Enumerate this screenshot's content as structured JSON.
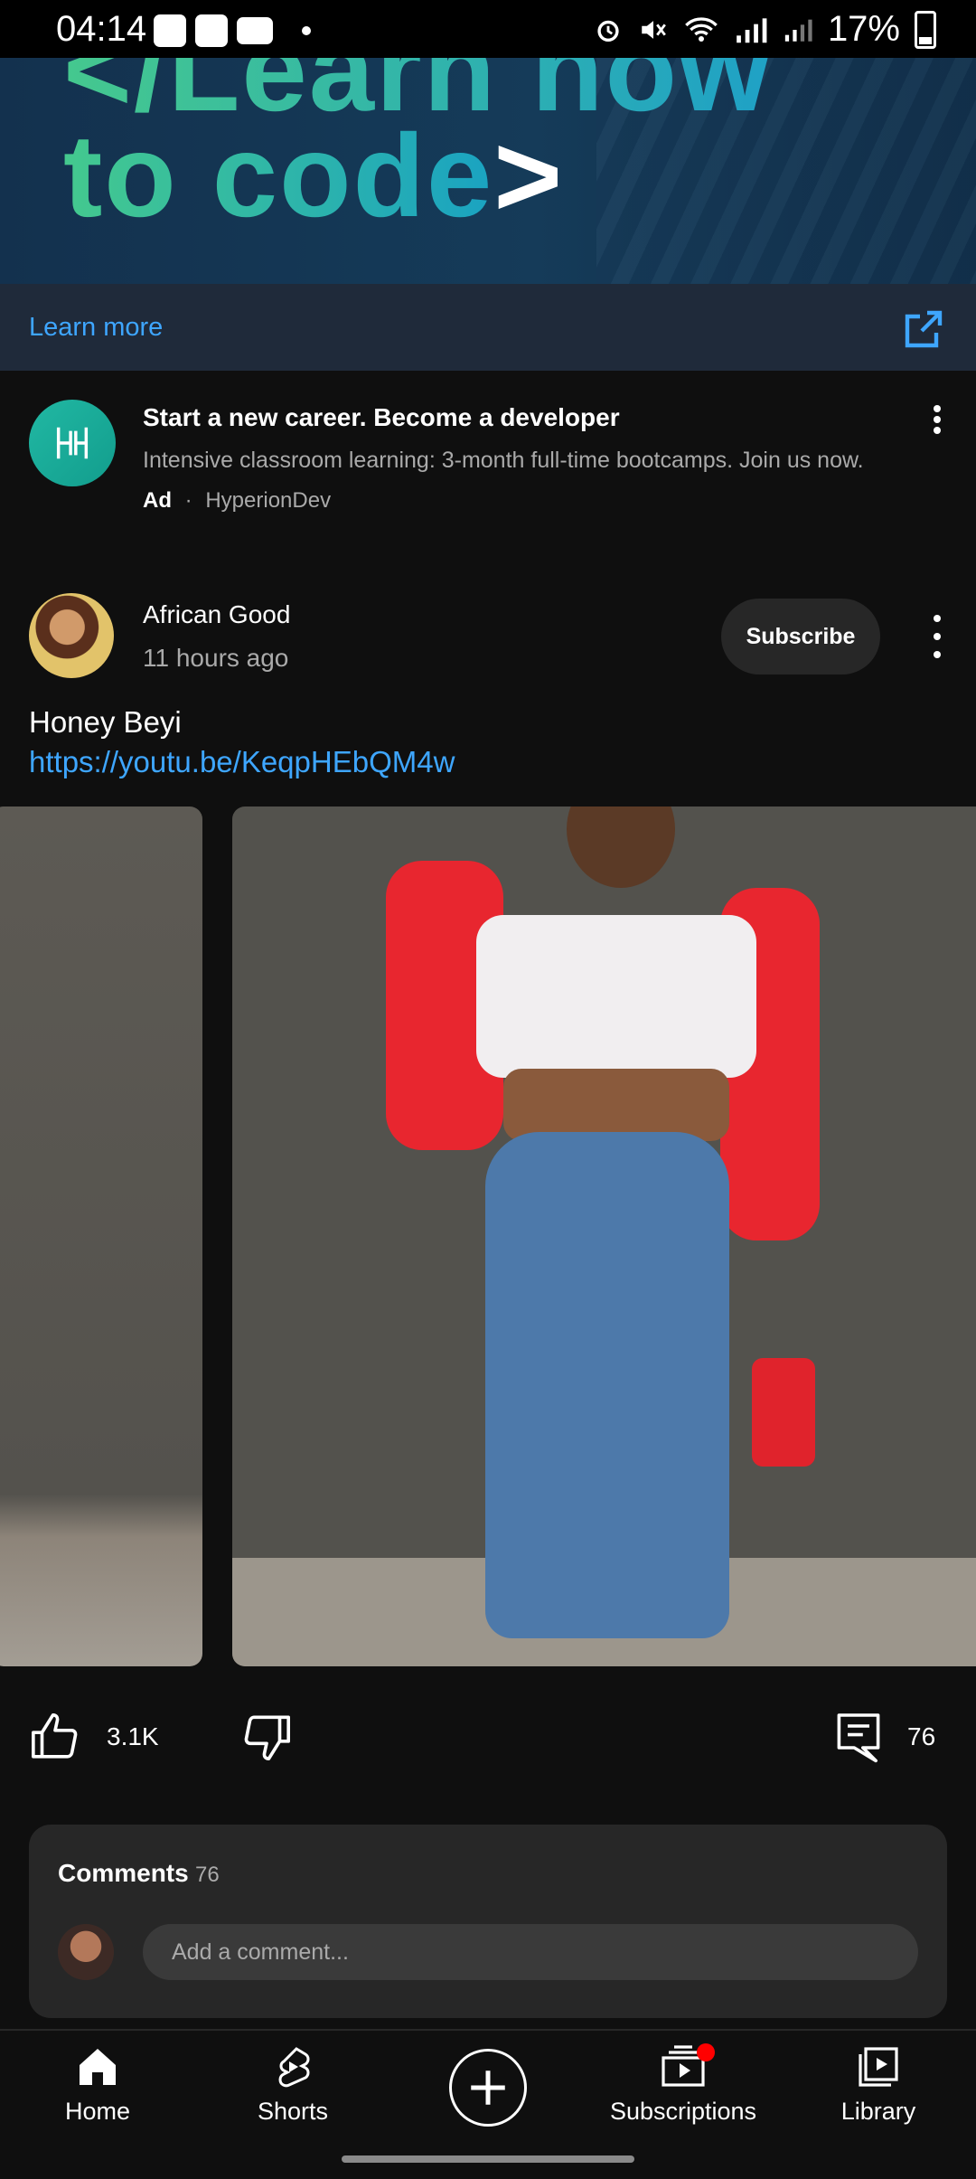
{
  "status_bar": {
    "time": "04:14",
    "battery": "17%"
  },
  "ad": {
    "banner_line1": "</Learn how",
    "banner_line2_a": "to code",
    "banner_line2_b": ">",
    "learn_more": "Learn more",
    "title": "Start a new career. Become a developer",
    "description": "Intensive classroom learning: 3-month full-time bootcamps. Join us now.",
    "badge": "Ad",
    "separator": "·",
    "advertiser": "HyperionDev"
  },
  "post": {
    "channel": "African Good",
    "time": "11 hours ago",
    "subscribe_label": "Subscribe",
    "title": "Honey Beyi",
    "link": "https://youtu.be/KeqpHEbQM4w"
  },
  "actions": {
    "likes": "3.1K",
    "comments": "76"
  },
  "comments": {
    "label": "Comments",
    "count": "76",
    "placeholder": "Add a comment..."
  },
  "nav": {
    "home": "Home",
    "shorts": "Shorts",
    "subscriptions": "Subscriptions",
    "library": "Library"
  },
  "colors": {
    "background": "#0f0f0f",
    "link": "#3ea6ff",
    "notification": "#ff0000"
  }
}
